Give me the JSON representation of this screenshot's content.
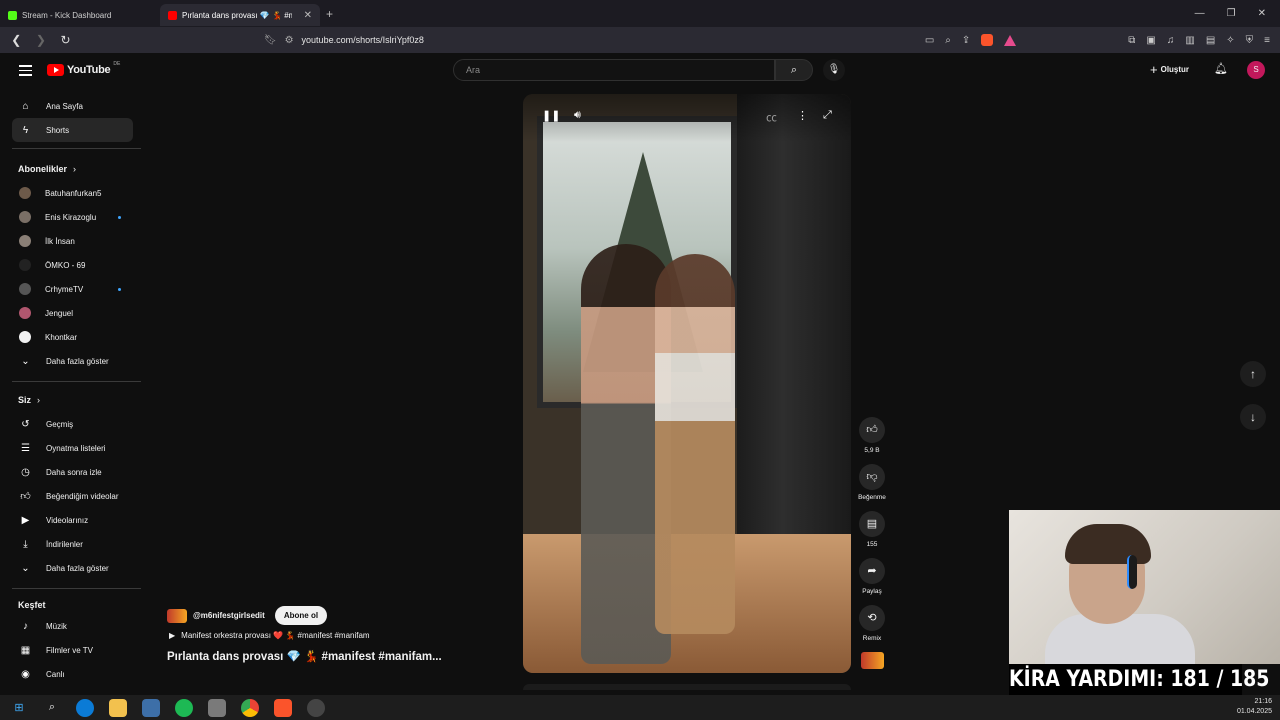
{
  "browser": {
    "tabs": [
      {
        "label": "Stream - Kick Dashboard",
        "active": false
      },
      {
        "label": "Pırlanta dans provası 💎 💃 #m",
        "active": true
      }
    ],
    "url": "youtube.com/shorts/IslriYpf0z8"
  },
  "header": {
    "logo": "YouTube",
    "country": "DE",
    "search_placeholder": "Ara",
    "create_label": "Oluştur",
    "avatar_letter": "S"
  },
  "sidebar": {
    "main": [
      {
        "label": "Ana Sayfa",
        "icon": "home-icon"
      },
      {
        "label": "Shorts",
        "icon": "shorts-icon",
        "active": true
      }
    ],
    "subscriptions_heading": "Abonelikler",
    "subscriptions": [
      {
        "label": "Batuhanfurkan5",
        "new": false
      },
      {
        "label": "Enis Kirazoglu",
        "new": true
      },
      {
        "label": "İlk İnsan",
        "new": false
      },
      {
        "label": "ÖMKO - 69",
        "new": false
      },
      {
        "label": "CrhymeTV",
        "new": true
      },
      {
        "label": "Jenguel",
        "new": false
      },
      {
        "label": "Khontkar",
        "new": false
      },
      {
        "label": "Daha fazla göster",
        "new": false
      }
    ],
    "you_heading": "Siz",
    "you": [
      {
        "label": "Geçmiş",
        "icon": "history-icon"
      },
      {
        "label": "Oynatma listeleri",
        "icon": "playlist-icon"
      },
      {
        "label": "Daha sonra izle",
        "icon": "clock-icon"
      },
      {
        "label": "Beğendiğim videolar",
        "icon": "like-icon"
      },
      {
        "label": "Videolarınız",
        "icon": "video-icon"
      },
      {
        "label": "İndirilenler",
        "icon": "download-icon"
      },
      {
        "label": "Daha fazla göster",
        "icon": "chevron-down-icon"
      }
    ],
    "explore_heading": "Keşfet",
    "explore": [
      {
        "label": "Müzik",
        "icon": "music-icon"
      },
      {
        "label": "Filmler ve TV",
        "icon": "film-icon"
      },
      {
        "label": "Canlı",
        "icon": "live-icon"
      }
    ]
  },
  "short": {
    "channel": "@m6nifestgirlsedit",
    "subscribe_label": "Abone ol",
    "music": "Manifest orkestra provası ❤️ 💃 #manifest #manifam",
    "title": "Pırlanta dans provası 💎 💃 #manifest #manifam...",
    "actions": {
      "likes": "5,9 B",
      "dislike_label": "Beğenme",
      "comments": "155",
      "share_label": "Paylaş",
      "remix_label": "Remix"
    }
  },
  "overlay": {
    "counter_text": "KİRA YARDIMI:  181 / 185"
  },
  "taskbar": {
    "time": "21:16",
    "date": "01.04.2025"
  }
}
